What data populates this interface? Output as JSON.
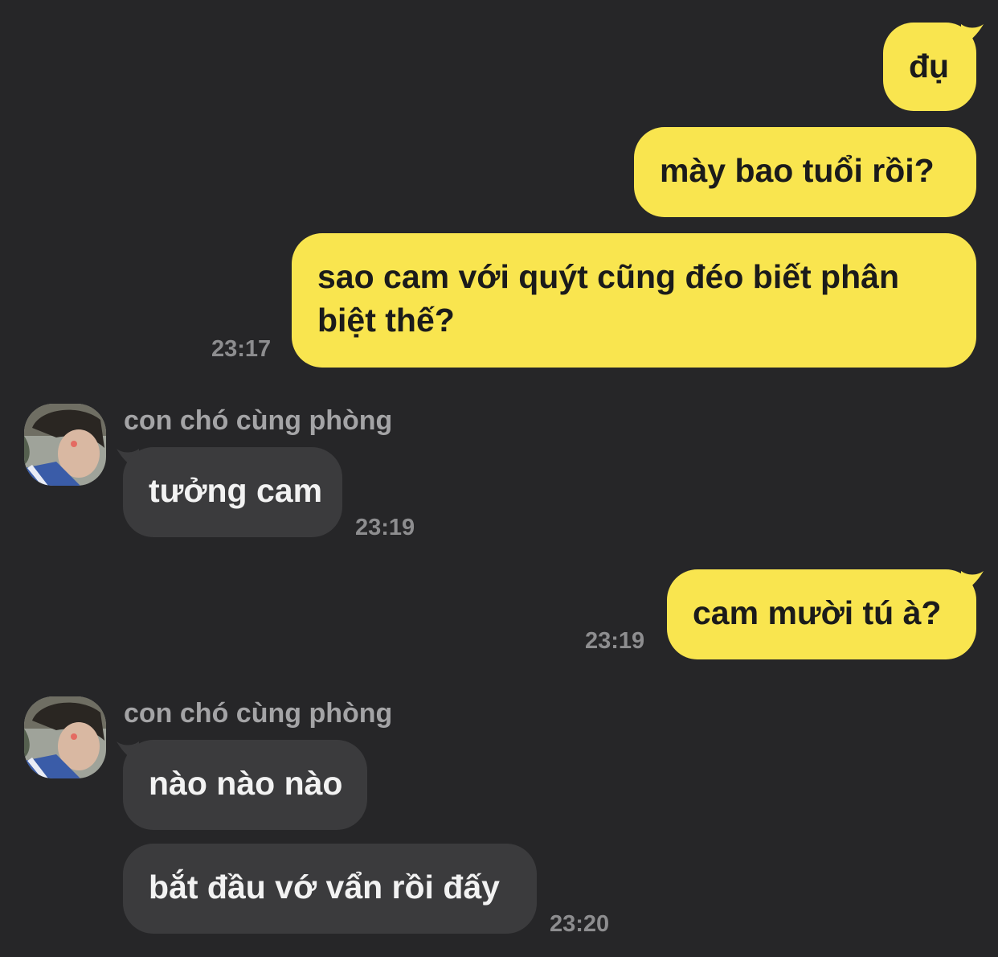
{
  "colors": {
    "background": "#262628",
    "my_bubble": "#f9e54f",
    "their_bubble": "#3b3b3d",
    "timestamp": "#8d8d8f",
    "sender_name": "#a4a4a6"
  },
  "chat": {
    "m1": {
      "text": "đụ"
    },
    "m2": {
      "text": "mày bao tuổi rồi?"
    },
    "m3": {
      "text": "sao cam với quýt cũng đéo biết phân biệt thế?"
    },
    "m3_time": "23:17",
    "group1": {
      "sender": "con chó cùng phòng",
      "avatar": "avatar-photo",
      "message": "tưởng cam",
      "time": "23:19"
    },
    "m4": {
      "text": "cam mười tú à?"
    },
    "m4_time": "23:19",
    "group2": {
      "sender": "con chó cùng phòng",
      "avatar": "avatar-photo",
      "messages": [
        "nào nào nào",
        "bắt đầu vớ vẩn rồi đấy"
      ],
      "time": "23:20"
    }
  }
}
